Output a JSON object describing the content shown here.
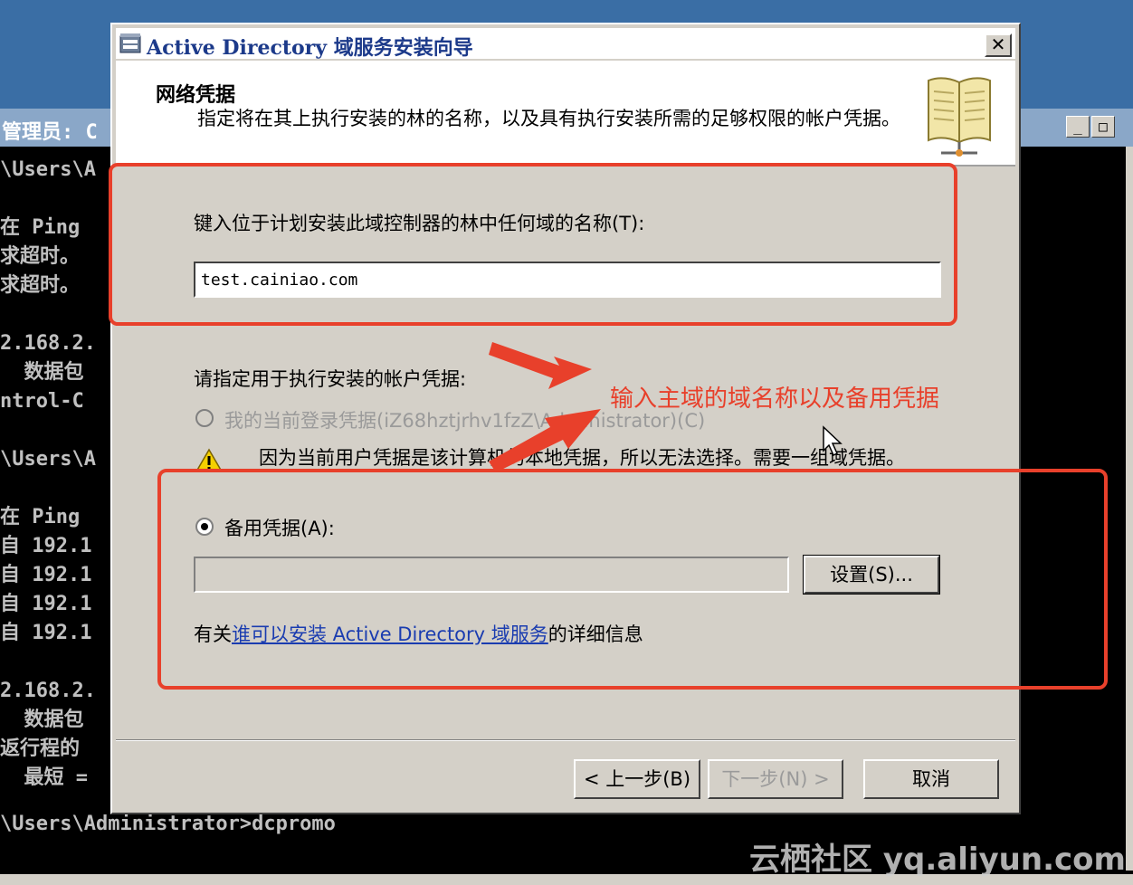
{
  "console": {
    "title": "管理员: C",
    "lines": "\\Users\\A\n\n在 Ping\n求超时。\n求超时。\n\n2.168.2.\n  数据包\nntrol-C\n\n\\Users\\A\n\n在 Ping\n自 192.1\n自 192.1\n自 192.1\n自 192.1\n\n2.168.2.\n  数据包\n返行程的\n  最短 =",
    "last_line": "\\Users\\Administrator>dcpromo",
    "buttons": [
      "_",
      "□"
    ]
  },
  "dialog": {
    "title": "Active Directory 域服务安装向导",
    "close": "✕",
    "header_title": "网络凭据",
    "header_desc": "指定将在其上执行安装的林的名称，以及具有执行安装所需的足够权限的帐户凭据。",
    "domain_label": "键入位于计划安装此域控制器的林中任何域的名称(T):",
    "domain_value": "test.cainiao.com",
    "credentials_label": "请指定用于执行安装的帐户凭据:",
    "current_cred_label": "我的当前登录凭据(iZ68hztjrhv1fzZ\\Administrator)(C)",
    "warning_text": "因为当前用户凭据是该计算机的本地凭据，所以无法选择。需要一组域凭据。",
    "alt_cred_label": "备用凭据(A):",
    "settings_button": "设置(S)...",
    "link_prefix": "有关",
    "link_text": "谁可以安装 Active Directory 域服务",
    "link_suffix": "的详细信息",
    "back_button": "< 上一步(B)",
    "next_button": "下一步(N) >",
    "cancel_button": "取消"
  },
  "annotation": {
    "text": "输入主域的域名称以及备用凭据",
    "color": "#e8402b"
  },
  "watermark": "云栖社区 yq.aliyun.com"
}
